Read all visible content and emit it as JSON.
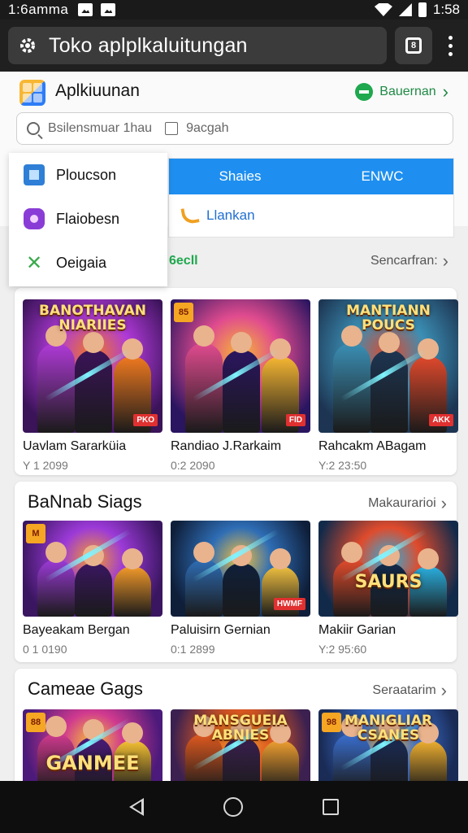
{
  "status_bar": {
    "time_left": "1:6amma",
    "time_right": "1:58"
  },
  "browser": {
    "url_title": "Toko aplplkaluitungan",
    "tabs_count": "8"
  },
  "header": {
    "app_name": "Aplkiuunan",
    "sort_label": "Bauernan"
  },
  "search": {
    "placeholder": "Bsilensmuar 1hau",
    "filter_label": "9acgah"
  },
  "dropdown": {
    "items": [
      {
        "label": "Ploucson",
        "icon": "box-icon"
      },
      {
        "label": "Flaiobesn",
        "icon": "gamepad-icon"
      },
      {
        "label": "Oeigaia",
        "icon": "tools-icon"
      }
    ]
  },
  "tabs": {
    "items": [
      "Shaies",
      "ENWC"
    ],
    "sub_link": "Llankan"
  },
  "section_label": {
    "left": "6ecll",
    "see_all": "Sencarfran:"
  },
  "sections": [
    {
      "title": "",
      "link": "",
      "apps": [
        {
          "name": "Uavlam Sararküia",
          "meta": "Y 1 2099",
          "banner": "BANOTHAVAN NIARIIES",
          "badge": "",
          "corner": "PKO",
          "palette": [
            "#3a1358",
            "#b03ad8",
            "#f07a20"
          ]
        },
        {
          "name": "Randiao J.Rarkaim",
          "meta": "0:2 2090",
          "banner": "",
          "badge": "85",
          "corner": "FlD",
          "palette": [
            "#2a1560",
            "#e04b8f",
            "#f7b733"
          ]
        },
        {
          "name": "Rahcakm ABagam",
          "meta": "Y:2 23:50",
          "banner": "MANTIANN POUCS",
          "badge": "",
          "corner": "AKK",
          "palette": [
            "#1d3552",
            "#3b8fb5",
            "#e0492c"
          ]
        }
      ]
    },
    {
      "title": "BaNnab Siags",
      "link": "Makaurarioi",
      "apps": [
        {
          "name": "Bayeakam Bergan",
          "meta": "0 1 0190",
          "banner": "",
          "badge": "M",
          "corner": "",
          "palette": [
            "#3a1660",
            "#9c3ad8",
            "#f59b2a"
          ]
        },
        {
          "name": "Paluisirn Gernian",
          "meta": "0:1 2899",
          "banner": "",
          "badge": "",
          "corner": "HWMF",
          "palette": [
            "#0f1f3a",
            "#2e6db5",
            "#f0c040"
          ]
        },
        {
          "name": "Makiir Garian",
          "meta": "Y:2 95:60",
          "banner": "SAURS",
          "badge": "",
          "corner": "",
          "palette": [
            "#122a4a",
            "#e04b2c",
            "#2ab0e0"
          ]
        }
      ]
    },
    {
      "title": "Cameae Gags",
      "link": "Seraatarim",
      "apps": [
        {
          "name": "",
          "meta": "",
          "banner": "GANMEE",
          "badge": "88",
          "corner": "",
          "palette": [
            "#4b1a7a",
            "#d03a8f",
            "#f7c333"
          ]
        },
        {
          "name": "",
          "meta": "",
          "banner": "MANSGUEIA ABNIES",
          "badge": "",
          "corner": "",
          "palette": [
            "#3b2050",
            "#e05a20",
            "#f0a030"
          ]
        },
        {
          "name": "",
          "meta": "",
          "banner": "MANIGLIAR CSANES",
          "badge": "98",
          "corner": "",
          "palette": [
            "#1a2b55",
            "#3a6fd0",
            "#f0b030"
          ]
        }
      ]
    }
  ]
}
